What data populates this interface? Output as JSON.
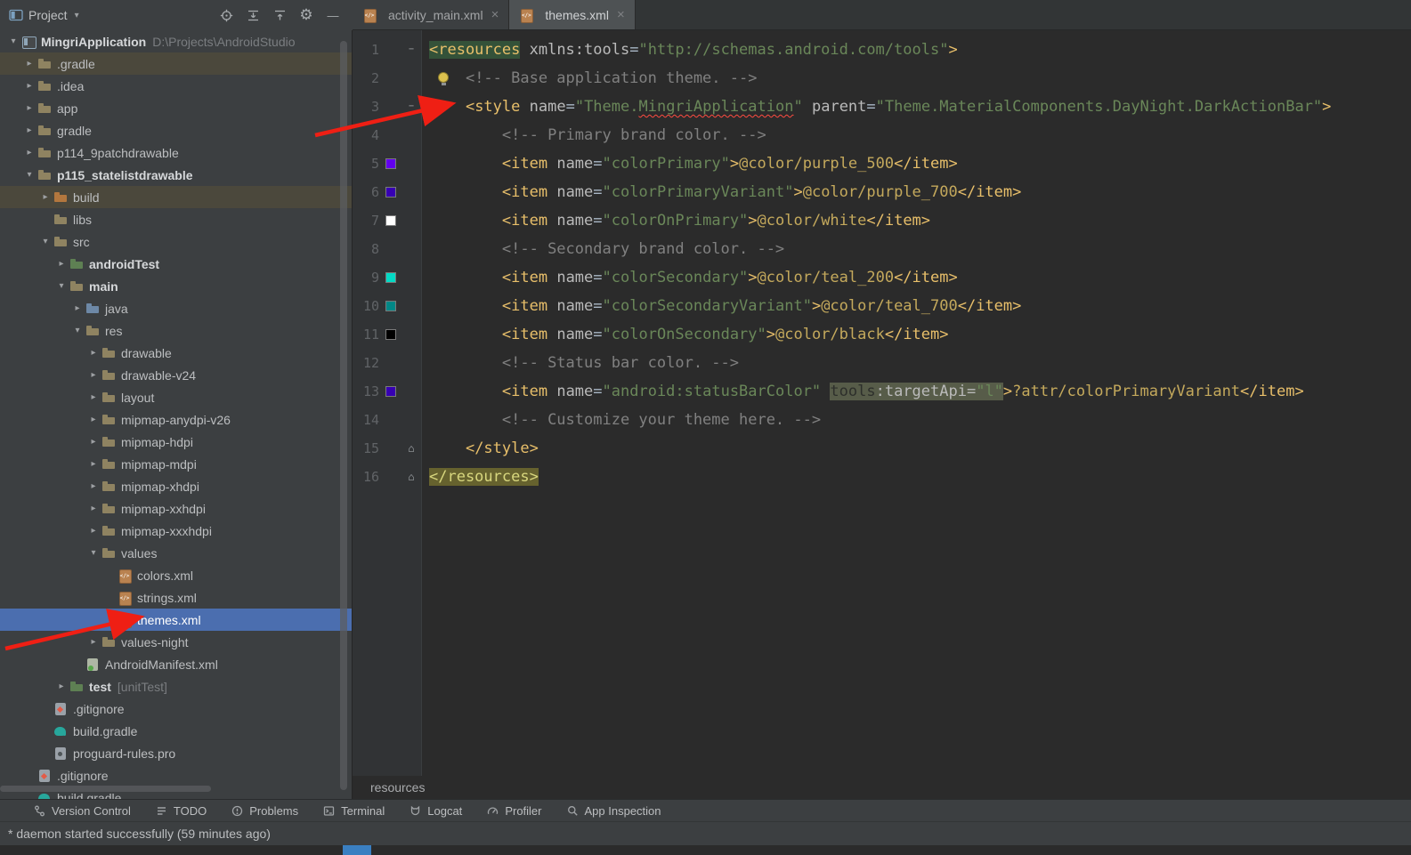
{
  "glyphs": {
    "dropdown": "▾",
    "gear": "⚙",
    "minimize": "—",
    "close": "×",
    "chevron_right": "▸",
    "chevron_down": "▾",
    "fold_end": "⌂",
    "fold_collapse": "−"
  },
  "project_panel": {
    "title": "Project"
  },
  "top_icons": [
    "project-tool-icon",
    "select-opened-file-icon",
    "expand-all-icon",
    "collapse-all-icon",
    "settings-gear-icon",
    "hide-panel-icon"
  ],
  "tabs": [
    {
      "label": "activity_main.xml",
      "active": false
    },
    {
      "label": "themes.xml",
      "active": true
    }
  ],
  "tree": {
    "items": [
      {
        "label": "MingriApplication",
        "suffix": "D:\\Projects\\AndroidStudio",
        "level": 0,
        "chevron": "v",
        "icon": "project",
        "bold": true
      },
      {
        "label": ".gradle",
        "level": 1,
        "chevron": ">",
        "icon": "folder",
        "rowbg": true
      },
      {
        "label": ".idea",
        "level": 1,
        "chevron": ">",
        "icon": "folder"
      },
      {
        "label": "app",
        "level": 1,
        "chevron": ">",
        "icon": "folder"
      },
      {
        "label": "gradle",
        "level": 1,
        "chevron": ">",
        "icon": "folder"
      },
      {
        "label": "p114_9patchdrawable",
        "level": 1,
        "chevron": ">",
        "icon": "folder"
      },
      {
        "label": "p115_statelistdrawable",
        "level": 1,
        "chevron": "v",
        "icon": "folder",
        "bold": true
      },
      {
        "label": "build",
        "level": 2,
        "chevron": ">",
        "icon": "folder-build",
        "rowbg": true
      },
      {
        "label": "libs",
        "level": 2,
        "chevron": "",
        "icon": "folder"
      },
      {
        "label": "src",
        "level": 2,
        "chevron": "v",
        "icon": "folder"
      },
      {
        "label": "androidTest",
        "level": 3,
        "chevron": ">",
        "icon": "folder-test",
        "bold": true
      },
      {
        "label": "main",
        "level": 3,
        "chevron": "v",
        "icon": "folder",
        "bold": true
      },
      {
        "label": "java",
        "level": 4,
        "chevron": ">",
        "icon": "folder-java"
      },
      {
        "label": "res",
        "level": 4,
        "chevron": "v",
        "icon": "folder-res"
      },
      {
        "label": "drawable",
        "level": 5,
        "chevron": ">",
        "icon": "folder"
      },
      {
        "label": "drawable-v24",
        "level": 5,
        "chevron": ">",
        "icon": "folder"
      },
      {
        "label": "layout",
        "level": 5,
        "chevron": ">",
        "icon": "folder"
      },
      {
        "label": "mipmap-anydpi-v26",
        "level": 5,
        "chevron": ">",
        "icon": "folder"
      },
      {
        "label": "mipmap-hdpi",
        "level": 5,
        "chevron": ">",
        "icon": "folder"
      },
      {
        "label": "mipmap-mdpi",
        "level": 5,
        "chevron": ">",
        "icon": "folder"
      },
      {
        "label": "mipmap-xhdpi",
        "level": 5,
        "chevron": ">",
        "icon": "folder"
      },
      {
        "label": "mipmap-xxhdpi",
        "level": 5,
        "chevron": ">",
        "icon": "folder"
      },
      {
        "label": "mipmap-xxxhdpi",
        "level": 5,
        "chevron": ">",
        "icon": "folder"
      },
      {
        "label": "values",
        "level": 5,
        "chevron": "v",
        "icon": "folder"
      },
      {
        "label": "colors.xml",
        "level": 6,
        "chevron": "",
        "icon": "xml"
      },
      {
        "label": "strings.xml",
        "level": 6,
        "chevron": "",
        "icon": "xml"
      },
      {
        "label": "themes.xml",
        "level": 6,
        "chevron": "",
        "icon": "xml",
        "selected": true
      },
      {
        "label": "values-night",
        "level": 5,
        "chevron": ">",
        "icon": "folder"
      },
      {
        "label": "AndroidManifest.xml",
        "level": 4,
        "chevron": "",
        "icon": "manifest"
      },
      {
        "label": "test",
        "suffix": "[unitTest]",
        "level": 3,
        "chevron": ">",
        "icon": "folder-test",
        "bold": true
      },
      {
        "label": ".gitignore",
        "level": 2,
        "chevron": "",
        "icon": "gitfile"
      },
      {
        "label": "build.gradle",
        "level": 2,
        "chevron": "",
        "icon": "gradlefile"
      },
      {
        "label": "proguard-rules.pro",
        "level": 2,
        "chevron": "",
        "icon": "profile"
      },
      {
        "label": ".gitignore",
        "level": 1,
        "chevron": "",
        "icon": "gitfile"
      },
      {
        "label": "build.gradle",
        "level": 1,
        "chevron": "",
        "icon": "gradlefile"
      }
    ]
  },
  "editor": {
    "breadcrumb": "resources",
    "lines": [
      {
        "n": 1,
        "fold": "open",
        "tokens": [
          {
            "t": "<resources",
            "c": "tag",
            "hl": "green"
          },
          {
            "t": " ",
            "c": "plain"
          },
          {
            "t": "xmlns:tools",
            "c": "attr"
          },
          {
            "t": "=",
            "c": "plain"
          },
          {
            "t": "\"http://schemas.android.com/tools\"",
            "c": "val"
          },
          {
            "t": ">",
            "c": "tag"
          }
        ]
      },
      {
        "n": 2,
        "bulb": true,
        "tokens": [
          {
            "t": "    ",
            "c": "plain"
          },
          {
            "t": "<!-- Base application theme. -->",
            "c": "comment"
          }
        ]
      },
      {
        "n": 3,
        "fold": "open",
        "tokens": [
          {
            "t": "    ",
            "c": "plain"
          },
          {
            "t": "<style",
            "c": "tag"
          },
          {
            "t": " ",
            "c": "plain"
          },
          {
            "t": "name",
            "c": "attr"
          },
          {
            "t": "=",
            "c": "plain"
          },
          {
            "t": "\"Theme.",
            "c": "val"
          },
          {
            "t": "MingriApplication",
            "c": "val",
            "err": true
          },
          {
            "t": "\"",
            "c": "val"
          },
          {
            "t": " ",
            "c": "plain"
          },
          {
            "t": "parent",
            "c": "attr"
          },
          {
            "t": "=",
            "c": "plain"
          },
          {
            "t": "\"Theme.MaterialComponents.DayNight.DarkActionBar\"",
            "c": "val"
          },
          {
            "t": ">",
            "c": "tag"
          }
        ]
      },
      {
        "n": 4,
        "tokens": [
          {
            "t": "        ",
            "c": "plain"
          },
          {
            "t": "<!-- Primary brand color. -->",
            "c": "comment"
          }
        ]
      },
      {
        "n": 5,
        "swatch": "#6200EE",
        "tokens": [
          {
            "t": "        ",
            "c": "plain"
          },
          {
            "t": "<item",
            "c": "tag"
          },
          {
            "t": " ",
            "c": "plain"
          },
          {
            "t": "name",
            "c": "attr"
          },
          {
            "t": "=",
            "c": "plain"
          },
          {
            "t": "\"colorPrimary\"",
            "c": "val"
          },
          {
            "t": ">",
            "c": "tag"
          },
          {
            "t": "@color/purple_500",
            "c": "ref"
          },
          {
            "t": "</item>",
            "c": "tag"
          }
        ]
      },
      {
        "n": 6,
        "swatch": "#3700B3",
        "tokens": [
          {
            "t": "        ",
            "c": "plain"
          },
          {
            "t": "<item",
            "c": "tag"
          },
          {
            "t": " ",
            "c": "plain"
          },
          {
            "t": "name",
            "c": "attr"
          },
          {
            "t": "=",
            "c": "plain"
          },
          {
            "t": "\"colorPrimaryVariant\"",
            "c": "val"
          },
          {
            "t": ">",
            "c": "tag"
          },
          {
            "t": "@color/purple_700",
            "c": "ref"
          },
          {
            "t": "</item>",
            "c": "tag"
          }
        ]
      },
      {
        "n": 7,
        "swatch": "#FFFFFF",
        "tokens": [
          {
            "t": "        ",
            "c": "plain"
          },
          {
            "t": "<item",
            "c": "tag"
          },
          {
            "t": " ",
            "c": "plain"
          },
          {
            "t": "name",
            "c": "attr"
          },
          {
            "t": "=",
            "c": "plain"
          },
          {
            "t": "\"colorOnPrimary\"",
            "c": "val"
          },
          {
            "t": ">",
            "c": "tag"
          },
          {
            "t": "@color/white",
            "c": "ref"
          },
          {
            "t": "</item>",
            "c": "tag"
          }
        ]
      },
      {
        "n": 8,
        "tokens": [
          {
            "t": "        ",
            "c": "plain"
          },
          {
            "t": "<!-- Secondary brand color. -->",
            "c": "comment"
          }
        ]
      },
      {
        "n": 9,
        "swatch": "#03DAC5",
        "tokens": [
          {
            "t": "        ",
            "c": "plain"
          },
          {
            "t": "<item",
            "c": "tag"
          },
          {
            "t": " ",
            "c": "plain"
          },
          {
            "t": "name",
            "c": "attr"
          },
          {
            "t": "=",
            "c": "plain"
          },
          {
            "t": "\"colorSecondary\"",
            "c": "val"
          },
          {
            "t": ">",
            "c": "tag"
          },
          {
            "t": "@color/teal_200",
            "c": "ref"
          },
          {
            "t": "</item>",
            "c": "tag"
          }
        ]
      },
      {
        "n": 10,
        "swatch": "#018786",
        "tokens": [
          {
            "t": "        ",
            "c": "plain"
          },
          {
            "t": "<item",
            "c": "tag"
          },
          {
            "t": " ",
            "c": "plain"
          },
          {
            "t": "name",
            "c": "attr"
          },
          {
            "t": "=",
            "c": "plain"
          },
          {
            "t": "\"colorSecondaryVariant\"",
            "c": "val"
          },
          {
            "t": ">",
            "c": "tag"
          },
          {
            "t": "@color/teal_700",
            "c": "ref"
          },
          {
            "t": "</item>",
            "c": "tag"
          }
        ]
      },
      {
        "n": 11,
        "swatch": "#000000",
        "tokens": [
          {
            "t": "        ",
            "c": "plain"
          },
          {
            "t": "<item",
            "c": "tag"
          },
          {
            "t": " ",
            "c": "plain"
          },
          {
            "t": "name",
            "c": "attr"
          },
          {
            "t": "=",
            "c": "plain"
          },
          {
            "t": "\"colorOnSecondary\"",
            "c": "val"
          },
          {
            "t": ">",
            "c": "tag"
          },
          {
            "t": "@color/black",
            "c": "ref"
          },
          {
            "t": "</item>",
            "c": "tag"
          }
        ]
      },
      {
        "n": 12,
        "tokens": [
          {
            "t": "        ",
            "c": "plain"
          },
          {
            "t": "<!-- Status bar color. -->",
            "c": "comment"
          }
        ]
      },
      {
        "n": 13,
        "swatch": "#3700B3",
        "tokens": [
          {
            "t": "        ",
            "c": "plain"
          },
          {
            "t": "<item",
            "c": "tag"
          },
          {
            "t": " ",
            "c": "plain"
          },
          {
            "t": "name",
            "c": "attr"
          },
          {
            "t": "=",
            "c": "plain"
          },
          {
            "t": "\"android:statusBarColor\"",
            "c": "val"
          },
          {
            "t": " ",
            "c": "plain"
          },
          {
            "t": "tools",
            "c": "dark",
            "hl": "olive"
          },
          {
            "t": ":targetApi=",
            "c": "attr",
            "hl": "olive"
          },
          {
            "t": "\"l\"",
            "c": "val",
            "hl": "olive"
          },
          {
            "t": ">",
            "c": "tag"
          },
          {
            "t": "?attr/colorPrimaryVariant",
            "c": "ref"
          },
          {
            "t": "</item>",
            "c": "tag"
          }
        ]
      },
      {
        "n": 14,
        "tokens": [
          {
            "t": "        ",
            "c": "plain"
          },
          {
            "t": "<!-- Customize your theme here. -->",
            "c": "comment"
          }
        ]
      },
      {
        "n": 15,
        "fold": "end",
        "tokens": [
          {
            "t": "    ",
            "c": "plain"
          },
          {
            "t": "</style>",
            "c": "tag"
          }
        ]
      },
      {
        "n": 16,
        "fold": "end",
        "tokens": [
          {
            "t": "</resources>",
            "c": "tag",
            "hl": "yellow"
          }
        ]
      }
    ]
  },
  "toolwindow_bar": {
    "items": [
      {
        "label": "Version Control",
        "icon": "git-branch-icon"
      },
      {
        "label": "TODO",
        "icon": "todo-list-icon"
      },
      {
        "label": "Problems",
        "icon": "problems-icon"
      },
      {
        "label": "Terminal",
        "icon": "terminal-icon"
      },
      {
        "label": "Logcat",
        "icon": "logcat-cat-icon"
      },
      {
        "label": "Profiler",
        "icon": "profiler-gauge-icon"
      },
      {
        "label": "App Inspection",
        "icon": "app-inspection-icon"
      }
    ]
  },
  "status_bar": {
    "message": "* daemon started successfully (59 minutes ago)"
  },
  "resource_colors": {
    "purple_500": "#6200EE",
    "purple_700": "#3700B3",
    "white": "#FFFFFF",
    "teal_200": "#03DAC5",
    "teal_700": "#018786",
    "black": "#000000"
  }
}
